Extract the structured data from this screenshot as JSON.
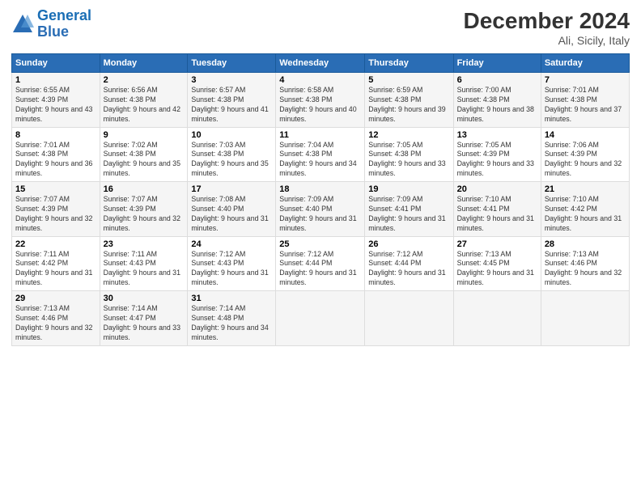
{
  "logo": {
    "line1": "General",
    "line2": "Blue"
  },
  "title": "December 2024",
  "subtitle": "Ali, Sicily, Italy",
  "days_header": [
    "Sunday",
    "Monday",
    "Tuesday",
    "Wednesday",
    "Thursday",
    "Friday",
    "Saturday"
  ],
  "weeks": [
    [
      {
        "day": "1",
        "sunrise": "6:55 AM",
        "sunset": "4:39 PM",
        "daylight": "9 hours and 43 minutes."
      },
      {
        "day": "2",
        "sunrise": "6:56 AM",
        "sunset": "4:38 PM",
        "daylight": "9 hours and 42 minutes."
      },
      {
        "day": "3",
        "sunrise": "6:57 AM",
        "sunset": "4:38 PM",
        "daylight": "9 hours and 41 minutes."
      },
      {
        "day": "4",
        "sunrise": "6:58 AM",
        "sunset": "4:38 PM",
        "daylight": "9 hours and 40 minutes."
      },
      {
        "day": "5",
        "sunrise": "6:59 AM",
        "sunset": "4:38 PM",
        "daylight": "9 hours and 39 minutes."
      },
      {
        "day": "6",
        "sunrise": "7:00 AM",
        "sunset": "4:38 PM",
        "daylight": "9 hours and 38 minutes."
      },
      {
        "day": "7",
        "sunrise": "7:01 AM",
        "sunset": "4:38 PM",
        "daylight": "9 hours and 37 minutes."
      }
    ],
    [
      {
        "day": "8",
        "sunrise": "7:01 AM",
        "sunset": "4:38 PM",
        "daylight": "9 hours and 36 minutes."
      },
      {
        "day": "9",
        "sunrise": "7:02 AM",
        "sunset": "4:38 PM",
        "daylight": "9 hours and 35 minutes."
      },
      {
        "day": "10",
        "sunrise": "7:03 AM",
        "sunset": "4:38 PM",
        "daylight": "9 hours and 35 minutes."
      },
      {
        "day": "11",
        "sunrise": "7:04 AM",
        "sunset": "4:38 PM",
        "daylight": "9 hours and 34 minutes."
      },
      {
        "day": "12",
        "sunrise": "7:05 AM",
        "sunset": "4:38 PM",
        "daylight": "9 hours and 33 minutes."
      },
      {
        "day": "13",
        "sunrise": "7:05 AM",
        "sunset": "4:39 PM",
        "daylight": "9 hours and 33 minutes."
      },
      {
        "day": "14",
        "sunrise": "7:06 AM",
        "sunset": "4:39 PM",
        "daylight": "9 hours and 32 minutes."
      }
    ],
    [
      {
        "day": "15",
        "sunrise": "7:07 AM",
        "sunset": "4:39 PM",
        "daylight": "9 hours and 32 minutes."
      },
      {
        "day": "16",
        "sunrise": "7:07 AM",
        "sunset": "4:39 PM",
        "daylight": "9 hours and 32 minutes."
      },
      {
        "day": "17",
        "sunrise": "7:08 AM",
        "sunset": "4:40 PM",
        "daylight": "9 hours and 31 minutes."
      },
      {
        "day": "18",
        "sunrise": "7:09 AM",
        "sunset": "4:40 PM",
        "daylight": "9 hours and 31 minutes."
      },
      {
        "day": "19",
        "sunrise": "7:09 AM",
        "sunset": "4:41 PM",
        "daylight": "9 hours and 31 minutes."
      },
      {
        "day": "20",
        "sunrise": "7:10 AM",
        "sunset": "4:41 PM",
        "daylight": "9 hours and 31 minutes."
      },
      {
        "day": "21",
        "sunrise": "7:10 AM",
        "sunset": "4:42 PM",
        "daylight": "9 hours and 31 minutes."
      }
    ],
    [
      {
        "day": "22",
        "sunrise": "7:11 AM",
        "sunset": "4:42 PM",
        "daylight": "9 hours and 31 minutes."
      },
      {
        "day": "23",
        "sunrise": "7:11 AM",
        "sunset": "4:43 PM",
        "daylight": "9 hours and 31 minutes."
      },
      {
        "day": "24",
        "sunrise": "7:12 AM",
        "sunset": "4:43 PM",
        "daylight": "9 hours and 31 minutes."
      },
      {
        "day": "25",
        "sunrise": "7:12 AM",
        "sunset": "4:44 PM",
        "daylight": "9 hours and 31 minutes."
      },
      {
        "day": "26",
        "sunrise": "7:12 AM",
        "sunset": "4:44 PM",
        "daylight": "9 hours and 31 minutes."
      },
      {
        "day": "27",
        "sunrise": "7:13 AM",
        "sunset": "4:45 PM",
        "daylight": "9 hours and 31 minutes."
      },
      {
        "day": "28",
        "sunrise": "7:13 AM",
        "sunset": "4:46 PM",
        "daylight": "9 hours and 32 minutes."
      }
    ],
    [
      {
        "day": "29",
        "sunrise": "7:13 AM",
        "sunset": "4:46 PM",
        "daylight": "9 hours and 32 minutes."
      },
      {
        "day": "30",
        "sunrise": "7:14 AM",
        "sunset": "4:47 PM",
        "daylight": "9 hours and 33 minutes."
      },
      {
        "day": "31",
        "sunrise": "7:14 AM",
        "sunset": "4:48 PM",
        "daylight": "9 hours and 34 minutes."
      },
      null,
      null,
      null,
      null
    ]
  ]
}
